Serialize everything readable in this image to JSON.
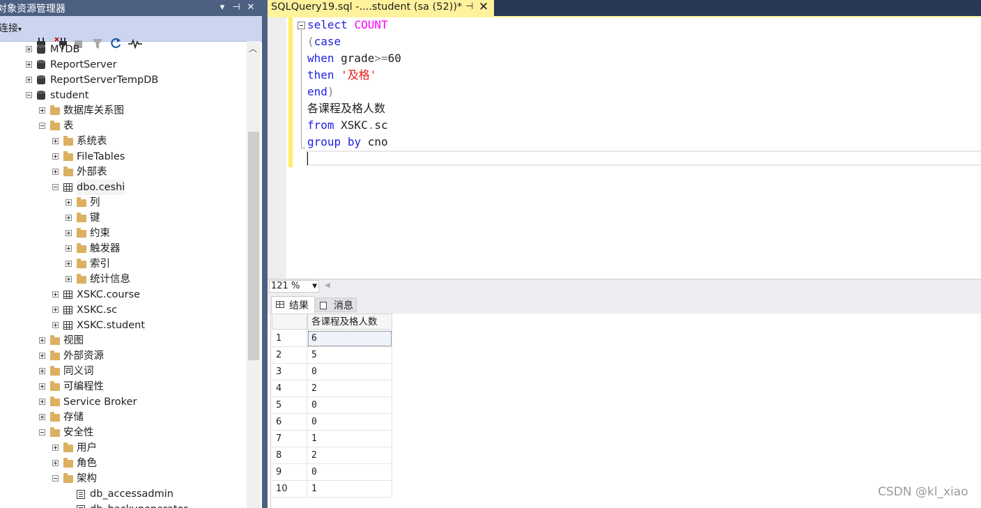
{
  "object_explorer": {
    "title": "对象资源管理器",
    "title_buttons": [
      "▾",
      "⊣",
      "✕"
    ],
    "toolbar": {
      "connect_label": "连接",
      "connect_dropdown": "▾"
    },
    "tree": [
      {
        "label": "MYDB",
        "icon": "database-icon",
        "level": 0,
        "state": "plus"
      },
      {
        "label": "ReportServer",
        "icon": "database-icon",
        "level": 0,
        "state": "plus"
      },
      {
        "label": "ReportServerTempDB",
        "icon": "database-icon",
        "level": 0,
        "state": "plus"
      },
      {
        "label": "student",
        "icon": "database-icon",
        "level": 0,
        "state": "minus"
      },
      {
        "label": "数据库关系图",
        "icon": "folder-icon",
        "level": 1,
        "state": "plus"
      },
      {
        "label": "表",
        "icon": "folder-icon",
        "level": 1,
        "state": "minus"
      },
      {
        "label": "系统表",
        "icon": "folder-icon",
        "level": 2,
        "state": "plus"
      },
      {
        "label": "FileTables",
        "icon": "folder-icon",
        "level": 2,
        "state": "plus"
      },
      {
        "label": "外部表",
        "icon": "folder-icon",
        "level": 2,
        "state": "plus"
      },
      {
        "label": "dbo.ceshi",
        "icon": "table-icon",
        "level": 2,
        "state": "minus",
        "selected": true
      },
      {
        "label": "列",
        "icon": "folder-icon",
        "level": 3,
        "state": "plus"
      },
      {
        "label": "键",
        "icon": "folder-icon",
        "level": 3,
        "state": "plus"
      },
      {
        "label": "约束",
        "icon": "folder-icon",
        "level": 3,
        "state": "plus"
      },
      {
        "label": "触发器",
        "icon": "folder-icon",
        "level": 3,
        "state": "plus"
      },
      {
        "label": "索引",
        "icon": "folder-icon",
        "level": 3,
        "state": "plus"
      },
      {
        "label": "统计信息",
        "icon": "folder-icon",
        "level": 3,
        "state": "plus"
      },
      {
        "label": "XSKC.course",
        "icon": "table-icon",
        "level": 2,
        "state": "plus"
      },
      {
        "label": "XSKC.sc",
        "icon": "table-icon",
        "level": 2,
        "state": "plus"
      },
      {
        "label": "XSKC.student",
        "icon": "table-icon",
        "level": 2,
        "state": "plus"
      },
      {
        "label": "视图",
        "icon": "folder-icon",
        "level": 1,
        "state": "plus"
      },
      {
        "label": "外部资源",
        "icon": "folder-icon",
        "level": 1,
        "state": "plus"
      },
      {
        "label": "同义词",
        "icon": "folder-icon",
        "level": 1,
        "state": "plus"
      },
      {
        "label": "可编程性",
        "icon": "folder-icon",
        "level": 1,
        "state": "plus"
      },
      {
        "label": "Service Broker",
        "icon": "folder-icon",
        "level": 1,
        "state": "plus"
      },
      {
        "label": "存储",
        "icon": "folder-icon",
        "level": 1,
        "state": "plus"
      },
      {
        "label": "安全性",
        "icon": "folder-icon",
        "level": 1,
        "state": "minus"
      },
      {
        "label": "用户",
        "icon": "folder-icon",
        "level": 2,
        "state": "plus"
      },
      {
        "label": "角色",
        "icon": "folder-icon",
        "level": 2,
        "state": "plus"
      },
      {
        "label": "架构",
        "icon": "folder-icon",
        "level": 2,
        "state": "minus"
      },
      {
        "label": "db_accessadmin",
        "icon": "schema-icon",
        "level": 3,
        "state": "none"
      },
      {
        "label": "db_backupoperator",
        "icon": "schema-icon",
        "level": 3,
        "state": "none"
      }
    ]
  },
  "document_tab": {
    "title": "SQLQuery19.sql -....student (sa (52))*",
    "pin": "⊣",
    "close": "✕"
  },
  "editor": {
    "lines": [
      [
        {
          "t": "select ",
          "c": "kw"
        },
        {
          "t": "COUNT",
          "c": "fn"
        }
      ],
      [
        {
          "t": "(",
          "c": "gr"
        },
        {
          "t": "case",
          "c": "kw"
        }
      ],
      [
        {
          "t": "when",
          "c": "kw"
        },
        {
          "t": " grade",
          "c": "tx"
        },
        {
          "t": ">=",
          "c": "gr"
        },
        {
          "t": "60",
          "c": "tx"
        }
      ],
      [
        {
          "t": "then ",
          "c": "kw"
        },
        {
          "t": "'及格'",
          "c": "str"
        }
      ],
      [
        {
          "t": "end",
          "c": "kw"
        },
        {
          "t": ")",
          "c": "gr"
        }
      ],
      [
        {
          "t": "各课程及格人数",
          "c": "tx"
        }
      ],
      [
        {
          "t": "from",
          "c": "kw"
        },
        {
          "t": " XSKC",
          "c": "tx"
        },
        {
          "t": ".",
          "c": "gr"
        },
        {
          "t": "sc",
          "c": "tx"
        }
      ],
      [
        {
          "t": "group",
          "c": "kw"
        },
        {
          "t": " ",
          "c": "tx"
        },
        {
          "t": "by",
          "c": "kw"
        },
        {
          "t": " cno",
          "c": "tx"
        }
      ]
    ]
  },
  "zoom": {
    "value": "121 %",
    "dropdown": "▼",
    "scroll_left": "◀"
  },
  "results": {
    "tabs": [
      {
        "label": "结果"
      },
      {
        "label": "消息"
      }
    ],
    "column": "各课程及格人数",
    "rows": [
      {
        "n": "1",
        "v": "6"
      },
      {
        "n": "2",
        "v": "5"
      },
      {
        "n": "3",
        "v": "0"
      },
      {
        "n": "4",
        "v": "2"
      },
      {
        "n": "5",
        "v": "0"
      },
      {
        "n": "6",
        "v": "0"
      },
      {
        "n": "7",
        "v": "1"
      },
      {
        "n": "8",
        "v": "2"
      },
      {
        "n": "9",
        "v": "0"
      },
      {
        "n": "10",
        "v": "1"
      }
    ]
  },
  "watermark": "CSDN @kl_xiao"
}
